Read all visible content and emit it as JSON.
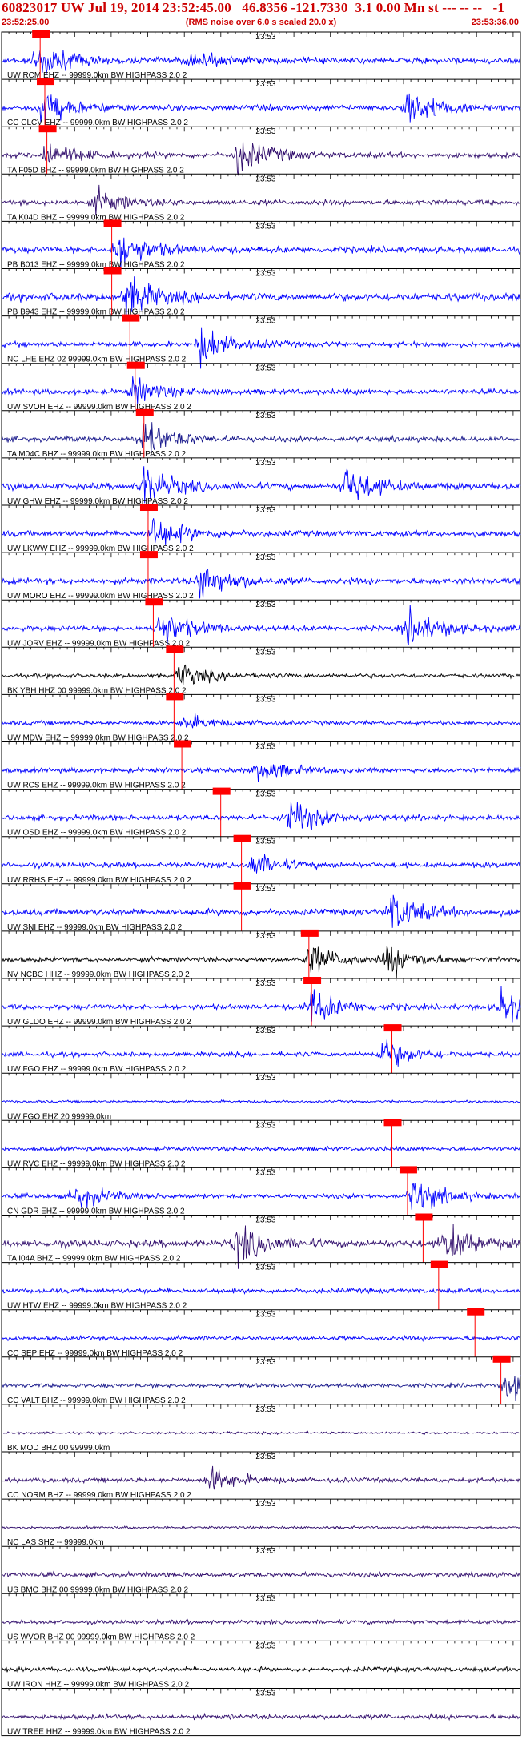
{
  "header": {
    "line1": "60823017 UW Jul 19, 2014 23:52:45.00   46.8356 -121.7330  3.1 0.00 Mn st --- -- --   -1",
    "start_time": "23:52:25.00",
    "note": "(RMS noise over 6.0 s scaled 20.0 x)",
    "end_time": "23:53:36.00"
  },
  "colors": {
    "frame": "#000000",
    "pick": "#ff0000",
    "header_text": "#cc0000",
    "blue": "#0000ff",
    "navy": "#1a1a8c",
    "purple": "#33106e",
    "black": "#000000"
  },
  "chart_data": {
    "type": "seismogram",
    "time_start": "23:52:25.00",
    "time_end": "23:53:36.00",
    "minute_label": "23:53",
    "channels": [
      {
        "label": "UW RCM EHZ -- 99999.0km BW  HIGHPASS  2.0  2",
        "pick_time": 0.062,
        "color": "blue",
        "amp": 0.6,
        "bursts": [
          [
            0.065,
            1.0
          ],
          [
            0.36,
            0.5
          ]
        ]
      },
      {
        "label": "CC CLCV EHZ -- 99999.0km BW  HIGHPASS  2.0  2",
        "pick_time": 0.071,
        "color": "blue",
        "amp": 0.5,
        "bursts": [
          [
            0.075,
            0.8
          ],
          [
            0.78,
            1.0
          ]
        ]
      },
      {
        "label": "TA F05D BHZ -- 99999.0km BW  HIGHPASS  2.0  2",
        "pick_time": 0.075,
        "color": "purple",
        "amp": 0.5,
        "bursts": [
          [
            0.08,
            0.7
          ],
          [
            0.45,
            1.0
          ]
        ]
      },
      {
        "label": "TA K04D BHZ -- 99999.0km BW  HIGHPASS  2.0  2",
        "pick_time": 0.0,
        "color": "purple",
        "amp": 0.5,
        "bursts": [
          [
            0.18,
            0.6
          ]
        ]
      },
      {
        "label": "PB B013 EHZ -- 99999.0km BW  HIGHPASS  2.0  2",
        "pick_time": 0.2,
        "color": "blue",
        "amp": 0.7,
        "bursts": [
          [
            0.22,
            1.0
          ]
        ]
      },
      {
        "label": "PB B943 EHZ -- 99999.0km BW  HIGHPASS  2.0  2",
        "pick_time": 0.2,
        "color": "blue",
        "amp": 0.9,
        "bursts": [
          [
            0.24,
            1.0
          ]
        ]
      },
      {
        "label": "NC LHE EHZ 02 99999.0km BW  HIGHPASS  2.0  2",
        "pick_time": 0.235,
        "color": "blue",
        "amp": 0.5,
        "bursts": [
          [
            0.38,
            1.0
          ]
        ]
      },
      {
        "label": "UW SVOH EHZ -- 99999.0km BW  HIGHPASS  2.0  2",
        "pick_time": 0.245,
        "color": "blue",
        "amp": 0.5,
        "bursts": [
          [
            0.25,
            0.7
          ]
        ]
      },
      {
        "label": "TA M04C BHZ -- 99999.0km BW  HIGHPASS  2.0  2",
        "pick_time": 0.262,
        "color": "navy",
        "amp": 0.5,
        "bursts": [
          [
            0.27,
            1.0
          ]
        ]
      },
      {
        "label": "UW GHW EHZ -- 99999.0km BW  HIGHPASS  2.0  2",
        "pick_time": 0.0,
        "color": "blue",
        "amp": 0.7,
        "bursts": [
          [
            0.27,
            1.0
          ],
          [
            0.66,
            1.0
          ]
        ]
      },
      {
        "label": "UW LKWW EHZ -- 99999.0km BW  HIGHPASS  2.0  2",
        "pick_time": 0.27,
        "color": "blue",
        "amp": 0.6,
        "bursts": [
          [
            0.29,
            0.8
          ]
        ]
      },
      {
        "label": "UW MORO EHZ -- 99999.0km BW  HIGHPASS  2.0  2",
        "pick_time": 0.27,
        "color": "blue",
        "amp": 0.6,
        "bursts": [
          [
            0.38,
            1.0
          ]
        ]
      },
      {
        "label": "UW JORV EHZ -- 99999.0km BW  HIGHPASS  2.0  2",
        "pick_time": 0.28,
        "color": "blue",
        "amp": 0.5,
        "bursts": [
          [
            0.3,
            1.0
          ],
          [
            0.78,
            1.0
          ]
        ]
      },
      {
        "label": "BK YBH HHZ 00 99999.0km BW  HIGHPASS  2.0  2",
        "pick_time": 0.32,
        "color": "black",
        "amp": 0.3,
        "bursts": [
          [
            0.34,
            0.6
          ]
        ]
      },
      {
        "label": "UW MDW EHZ -- 99999.0km BW  HIGHPASS  2.0  2",
        "pick_time": 0.32,
        "color": "blue",
        "amp": 0.3,
        "bursts": [
          [
            0.35,
            0.4
          ]
        ]
      },
      {
        "label": "UW RCS EHZ -- 99999.0km BW  HIGHPASS  2.0  2",
        "pick_time": 0.335,
        "color": "blue",
        "amp": 0.4,
        "bursts": [
          [
            0.49,
            0.6
          ]
        ]
      },
      {
        "label": "UW OSD EHZ -- 99999.0km BW  HIGHPASS  2.0  2",
        "pick_time": 0.41,
        "color": "blue",
        "amp": 0.5,
        "bursts": [
          [
            0.55,
            1.0
          ]
        ]
      },
      {
        "label": "UW RRHS EHZ -- 99999.0km BW  HIGHPASS  2.0  2",
        "pick_time": 0.45,
        "color": "blue",
        "amp": 0.5,
        "bursts": [
          [
            0.48,
            0.6
          ]
        ]
      },
      {
        "label": "UW SNI EHZ -- 99999.0km BW  HIGHPASS  2.0  2",
        "pick_time": 0.45,
        "color": "blue",
        "amp": 0.7,
        "bursts": [
          [
            0.75,
            1.0
          ]
        ]
      },
      {
        "label": "NV NCBC HHZ -- 99999.0km BW  HIGHPASS  2.0  2",
        "pick_time": 0.58,
        "color": "black",
        "amp": 0.4,
        "bursts": [
          [
            0.59,
            0.8
          ],
          [
            0.74,
            0.8
          ]
        ]
      },
      {
        "label": "UW GLDO EHZ -- 99999.0km BW  HIGHPASS  2.0  2",
        "pick_time": 0.585,
        "color": "blue",
        "amp": 0.5,
        "bursts": [
          [
            0.59,
            1.0
          ],
          [
            0.96,
            0.9
          ]
        ]
      },
      {
        "label": "UW FGO EHZ -- 99999.0km BW  HIGHPASS  2.0  2",
        "pick_time": 0.74,
        "color": "blue",
        "amp": 0.4,
        "bursts": [
          [
            0.73,
            0.8
          ]
        ]
      },
      {
        "label": "UW FGO EHZ 20 99999.0km",
        "pick_time": 0.0,
        "color": "blue",
        "amp": 0.0,
        "bursts": []
      },
      {
        "label": "UW RVC EHZ -- 99999.0km BW  HIGHPASS  2.0  2",
        "pick_time": 0.74,
        "color": "blue",
        "amp": 0.3,
        "bursts": []
      },
      {
        "label": "CN GDR EHZ -- 99999.0km BW  HIGHPASS  2.0  2",
        "pick_time": 0.77,
        "color": "blue",
        "amp": 0.4,
        "bursts": [
          [
            0.14,
            0.6
          ],
          [
            0.79,
            0.9
          ]
        ]
      },
      {
        "label": "TA I04A BHZ -- 99999.0km BW  HIGHPASS  2.0  2",
        "pick_time": 0.8,
        "color": "purple",
        "amp": 0.8,
        "bursts": [
          [
            0.45,
            1.0
          ],
          [
            0.85,
            1.0
          ]
        ]
      },
      {
        "label": "UW HTW EHZ -- 99999.0km BW  HIGHPASS  2.0  2",
        "pick_time": 0.83,
        "color": "blue",
        "amp": 0.4,
        "bursts": []
      },
      {
        "label": "CC SEP EHZ -- 99999.0km BW  HIGHPASS  2.0  2",
        "pick_time": 0.9,
        "color": "blue",
        "amp": 0.3,
        "bursts": []
      },
      {
        "label": "CC VALT BHZ -- 99999.0km BW  HIGHPASS  2.0  2",
        "pick_time": 0.95,
        "color": "navy",
        "amp": 0.3,
        "bursts": [
          [
            0.97,
            0.8
          ]
        ]
      },
      {
        "label": "BK MOD BHZ 00 99999.0km",
        "pick_time": 0.0,
        "color": "purple",
        "amp": 0.0,
        "bursts": []
      },
      {
        "label": "CC NORM BHZ -- 99999.0km BW  HIGHPASS  2.0  2",
        "pick_time": 0.0,
        "color": "purple",
        "amp": 0.4,
        "bursts": [
          [
            0.4,
            0.6
          ]
        ]
      },
      {
        "label": "NC LAS SHZ -- 99999.0km",
        "pick_time": 0.0,
        "color": "purple",
        "amp": 0.0,
        "bursts": []
      },
      {
        "label": "US BMO BHZ 00 99999.0km BW  HIGHPASS  2.0  2",
        "pick_time": 0.0,
        "color": "purple",
        "amp": 0.4,
        "bursts": []
      },
      {
        "label": "US WVOR BHZ 00 99999.0km BW  HIGHPASS  2.0  2",
        "pick_time": 0.0,
        "color": "purple",
        "amp": 0.3,
        "bursts": []
      },
      {
        "label": "UW IRON HHZ -- 99999.0km BW  HIGHPASS  2.0  2",
        "pick_time": 0.0,
        "color": "black",
        "amp": 0.4,
        "bursts": []
      },
      {
        "label": "UW TREE HHZ -- 99999.0km BW  HIGHPASS  2.0  2",
        "pick_time": 0.0,
        "color": "purple",
        "amp": 0.4,
        "bursts": []
      }
    ]
  }
}
